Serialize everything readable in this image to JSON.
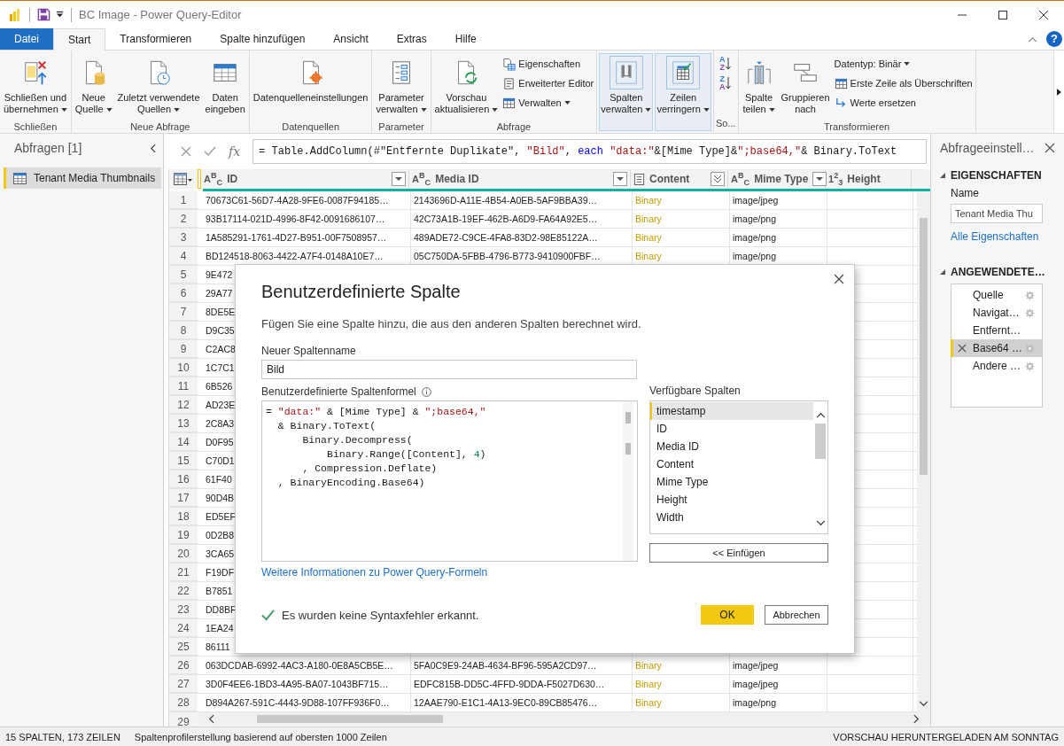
{
  "window": {
    "title": "BC Image - Power Query-Editor"
  },
  "tabs": [
    {
      "label": "Datei",
      "kind": "file",
      "selected": false
    },
    {
      "label": "Start",
      "kind": "tab",
      "selected": true
    },
    {
      "label": "Transformieren",
      "kind": "tab",
      "selected": false
    },
    {
      "label": "Spalte hinzufügen",
      "kind": "tab",
      "selected": false
    },
    {
      "label": "Ansicht",
      "kind": "tab",
      "selected": false
    },
    {
      "label": "Extras",
      "kind": "tab",
      "selected": false
    },
    {
      "label": "Hilfe",
      "kind": "tab",
      "selected": false
    }
  ],
  "help": "?",
  "ribbon": {
    "groups": [
      {
        "label": "Schließen",
        "buttons": [
          {
            "lines": [
              "Schließen und",
              "übernehmen"
            ],
            "dropdown": true,
            "highlighted": false
          }
        ]
      },
      {
        "label": "Neue Abfrage",
        "buttons": [
          {
            "lines": [
              "Neue",
              "Quelle"
            ],
            "dropdown": true,
            "highlighted": false
          },
          {
            "lines": [
              "Zuletzt verwendete",
              "Quellen"
            ],
            "dropdown": true,
            "highlighted": false
          },
          {
            "lines": [
              "Daten",
              "eingeben"
            ],
            "dropdown": false,
            "highlighted": false
          }
        ]
      },
      {
        "label": "Datenquellen",
        "buttons": [
          {
            "lines": [
              "Datenquelleneinstellungen"
            ],
            "dropdown": false,
            "highlighted": false
          }
        ]
      },
      {
        "label": "Parameter",
        "buttons": [
          {
            "lines": [
              "Parameter",
              "verwalten"
            ],
            "dropdown": true,
            "highlighted": false
          }
        ]
      },
      {
        "label": "Abfrage",
        "buttons": [
          {
            "lines": [
              "Vorschau",
              "aktualisieren"
            ],
            "dropdown": true,
            "highlighted": false
          }
        ],
        "small": [
          {
            "label": "Eigenschaften",
            "dropdown": false
          },
          {
            "label": "Erweiterter Editor",
            "dropdown": false
          },
          {
            "label": "Verwalten",
            "dropdown": true
          }
        ]
      },
      {
        "buttons": [
          {
            "lines": [
              "Spalten",
              "verwalten"
            ],
            "dropdown": true,
            "highlighted": true
          },
          {
            "lines": [
              "Zeilen",
              "verringern"
            ],
            "dropdown": true,
            "highlighted": true
          }
        ]
      },
      {
        "label": "So...",
        "sort_buttons": [
          {
            "top": "A",
            "bottom": "Z"
          },
          {
            "top": "Z",
            "bottom": "A"
          }
        ]
      },
      {
        "label": "Transformieren",
        "buttons": [
          {
            "lines": [
              "Spalte",
              "teilen"
            ],
            "dropdown": true,
            "highlighted": false
          },
          {
            "lines": [
              "Gruppieren",
              "nach"
            ],
            "dropdown": false,
            "highlighted": false
          }
        ],
        "small": [
          {
            "label": "Datentyp: Binär",
            "dropdown": true
          },
          {
            "label": "Erste Zeile als Überschriften",
            "dropdown": false
          },
          {
            "label": "Werte ersetzen",
            "dropdown": false
          }
        ]
      }
    ]
  },
  "queries": {
    "title": "Abfragen [1]",
    "items": [
      {
        "name": "Tenant Media Thumbnails",
        "selected": true
      }
    ]
  },
  "formula_bar": {
    "fx": "fx",
    "segments": [
      {
        "text": "= Table.AddColumn(#\"Entfernte Duplikate\", ",
        "kind": "plain"
      },
      {
        "text": "\"Bild\"",
        "kind": "string"
      },
      {
        "text": ", ",
        "kind": "plain"
      },
      {
        "text": "each",
        "kind": "keyword"
      },
      {
        "text": " \"data:\"",
        "kind": "string"
      },
      {
        "text": "&[Mime Type]&",
        "kind": "plain"
      },
      {
        "text": "\";base64,\"",
        "kind": "string"
      },
      {
        "text": "& Binary.ToText",
        "kind": "plain"
      }
    ]
  },
  "table": {
    "columns": [
      {
        "name": "ID",
        "kind": "text",
        "type_label": "A$^{B}$$_{C}$",
        "filter": true,
        "expand": false
      },
      {
        "name": "Media ID",
        "kind": "text",
        "type_label": "A$^{B}$$_{C}$",
        "filter": true,
        "expand": false
      },
      {
        "name": "Content",
        "kind": "binary",
        "filter": false,
        "expand": true
      },
      {
        "name": "Mime Type",
        "kind": "text",
        "type_label": "A$^{B}$$_{C}$",
        "filter": true,
        "expand": false
      },
      {
        "name": "Height",
        "kind": "number",
        "type_label": "1$^{2}$$_{3}$",
        "filter": false,
        "expand": false
      }
    ],
    "rows": [
      {
        "number": "1",
        "cells": [
          "70673C61-56D7-4A28-9FE6-0087F94185…",
          "2143696D-A11E-4B54-A0EB-5AF9BBA39…",
          "Binary",
          "image/jpeg"
        ]
      },
      {
        "number": "2",
        "cells": [
          "93B17114-021D-4996-8F42-0091686107…",
          "42C73A1B-19EF-462B-A6D9-FA64A92E5…",
          "Binary",
          "image/png"
        ]
      },
      {
        "number": "3",
        "cells": [
          "1A585291-1761-4D27-B951-00F7508957…",
          "489ADE72-C9CE-4FA8-83D2-98E85122A…",
          "Binary",
          "image/png"
        ]
      },
      {
        "number": "4",
        "cells": [
          "BD124518-8063-4422-A7F4-0148A10E7…",
          "05C750DA-5FBB-4796-B773-9410900FBF…",
          "Binary",
          "image/png"
        ]
      },
      {
        "number": "5",
        "cells": [
          "9E472"
        ]
      },
      {
        "number": "6",
        "cells": [
          "29A77"
        ]
      },
      {
        "number": "7",
        "cells": [
          "8DE5E"
        ]
      },
      {
        "number": "8",
        "cells": [
          "D9C35"
        ]
      },
      {
        "number": "9",
        "cells": [
          "C2AC8"
        ]
      },
      {
        "number": "10",
        "cells": [
          "1C7C1"
        ]
      },
      {
        "number": "11",
        "cells": [
          "6B526"
        ]
      },
      {
        "number": "12",
        "cells": [
          "AD23E"
        ]
      },
      {
        "number": "13",
        "cells": [
          "2C8A3"
        ]
      },
      {
        "number": "14",
        "cells": [
          "D0F95"
        ]
      },
      {
        "number": "15",
        "cells": [
          "C70D1"
        ]
      },
      {
        "number": "16",
        "cells": [
          "61F40"
        ]
      },
      {
        "number": "17",
        "cells": [
          "90D4B"
        ]
      },
      {
        "number": "18",
        "cells": [
          "ED5EF"
        ]
      },
      {
        "number": "19",
        "cells": [
          "0D2B8"
        ]
      },
      {
        "number": "20",
        "cells": [
          "3CA65"
        ]
      },
      {
        "number": "21",
        "cells": [
          "F19DF"
        ]
      },
      {
        "number": "22",
        "cells": [
          "B7851"
        ]
      },
      {
        "number": "23",
        "cells": [
          "DD8BF"
        ]
      },
      {
        "number": "24",
        "cells": [
          "1EA24"
        ]
      },
      {
        "number": "25",
        "cells": [
          "86111"
        ]
      },
      {
        "number": "26",
        "cells": [
          "063DCDAB-6992-4AC3-A180-0E8A5CB5E…",
          "5FA0C9E9-24AB-4634-BF96-595A2CD97…",
          "Binary",
          "image/jpeg"
        ]
      },
      {
        "number": "27",
        "cells": [
          "3D0F4EE6-1BD3-4A95-BA07-1043BF715…",
          "EDFC815B-DD5C-4FFD-9DDA-F5027D630…",
          "Binary",
          "image/jpeg"
        ]
      },
      {
        "number": "28",
        "cells": [
          "D894A267-591C-4443-9D88-107FF936F0…",
          "12AAE790-E1C1-4A13-9EC0-89CB85476…",
          "Binary",
          "image/png"
        ]
      }
    ],
    "last_row_number": "29"
  },
  "settings": {
    "title": "Abfrageeinstell…",
    "properties_heading": "EIGENSCHAFTEN",
    "name_label": "Name",
    "name_value": "Tenant Media Thu",
    "link": "Alle Eigenschaften",
    "steps_heading": "ANGEWENDETE…",
    "steps": [
      {
        "name": "Quelle",
        "settings": true,
        "selected": false
      },
      {
        "name": "Navigat…",
        "settings": true,
        "selected": false
      },
      {
        "name": "Entfernt…",
        "settings": false,
        "selected": false
      },
      {
        "name": "Base64 …",
        "settings": true,
        "selected": true
      },
      {
        "name": "Andere …",
        "settings": true,
        "selected": false
      }
    ]
  },
  "dialog": {
    "title": "Benutzerdefinierte Spalte",
    "description": "Fügen Sie eine Spalte hinzu, die aus den anderen Spalten berechnet wird.",
    "name_label": "Neuer Spaltenname",
    "name_value": "Bild",
    "formula_label": "Benutzerdefinierte Spaltenformel",
    "formula_lines": [
      [
        {
          "text": "= ",
          "kind": "plain"
        },
        {
          "text": "\"data:\"",
          "kind": "string"
        },
        {
          "text": " & [Mime Type] & ",
          "kind": "plain"
        },
        {
          "text": "\";base64,\"",
          "kind": "string"
        }
      ],
      [
        {
          "text": "  & Binary.ToText(",
          "kind": "plain"
        }
      ],
      [
        {
          "text": "      Binary.Decompress(",
          "kind": "plain"
        }
      ],
      [
        {
          "text": "          Binary.Range([Content], ",
          "kind": "plain"
        },
        {
          "text": "4",
          "kind": "number"
        },
        {
          "text": ")",
          "kind": "plain"
        }
      ],
      [
        {
          "text": "      , Compression.Deflate)",
          "kind": "plain"
        }
      ],
      [
        {
          "text": "  , BinaryEncoding.Base64)",
          "kind": "plain"
        }
      ]
    ],
    "columns_label": "Verfügbare Spalten",
    "columns": [
      {
        "name": "timestamp",
        "selected": true
      },
      {
        "name": "ID",
        "selected": false
      },
      {
        "name": "Media ID",
        "selected": false
      },
      {
        "name": "Content",
        "selected": false
      },
      {
        "name": "Mime Type",
        "selected": false
      },
      {
        "name": "Height",
        "selected": false
      },
      {
        "name": "Width",
        "selected": false
      }
    ],
    "insert_button": "<< Einfügen",
    "help_link": "Weitere Informationen zu Power Query-Formeln",
    "status": "Es wurden keine Syntaxfehler erkannt.",
    "status_ok": true,
    "ok_button": "OK",
    "cancel_button": "Abbrechen"
  },
  "status_bar": {
    "left": "15 SPALTEN, 173 ZEILEN",
    "middle": "Spaltenprofilerstellung basierend auf obersten 1000 Zeilen",
    "right": "VORSCHAU HERUNTERGELADEN AM SONNTAG"
  }
}
